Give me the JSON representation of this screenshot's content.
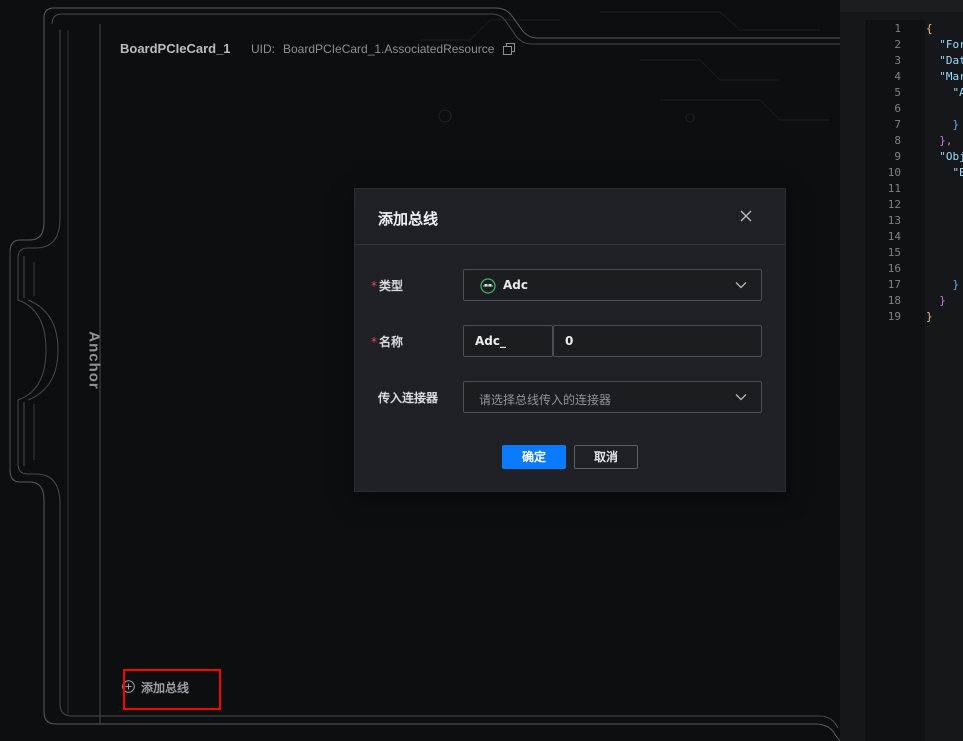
{
  "board": {
    "title": "BoardPCIeCard_1",
    "uid_label": "UID:",
    "uid_value": "BoardPCIeCard_1.AssociatedResource",
    "anchor_label": "Anchor"
  },
  "code_panel": {
    "line_numbers": [
      "1",
      "2",
      "3",
      "4",
      "5",
      "6",
      "7",
      "8",
      "9",
      "10",
      "11",
      "12",
      "13",
      "14",
      "15",
      "16",
      "17",
      "18",
      "19"
    ],
    "lines": [
      "{",
      "  \"For",
      "  \"Dat",
      "  \"Mar",
      "    \"A",
      "",
      "    }",
      "  },",
      "  \"Obj",
      "    \"B",
      "",
      "",
      "",
      "",
      "",
      "",
      "    }",
      "  }",
      "}"
    ]
  },
  "dialog": {
    "title": "添加总线",
    "type": {
      "label": "类型",
      "required": "*",
      "value": "Adc",
      "icon": "adc-bus-icon"
    },
    "name": {
      "label": "名称",
      "required": "*",
      "prefix": "Adc_",
      "value": "0"
    },
    "connector": {
      "label": "传入连接器",
      "placeholder": "请选择总线传入的连接器"
    },
    "confirm_label": "确定",
    "cancel_label": "取消"
  },
  "add_bus": {
    "label": "添加总线",
    "icon": "plus-circle-icon"
  },
  "colors": {
    "primary": "#0a7aff",
    "required": "#e5484d",
    "highlight": "#ff0000"
  }
}
